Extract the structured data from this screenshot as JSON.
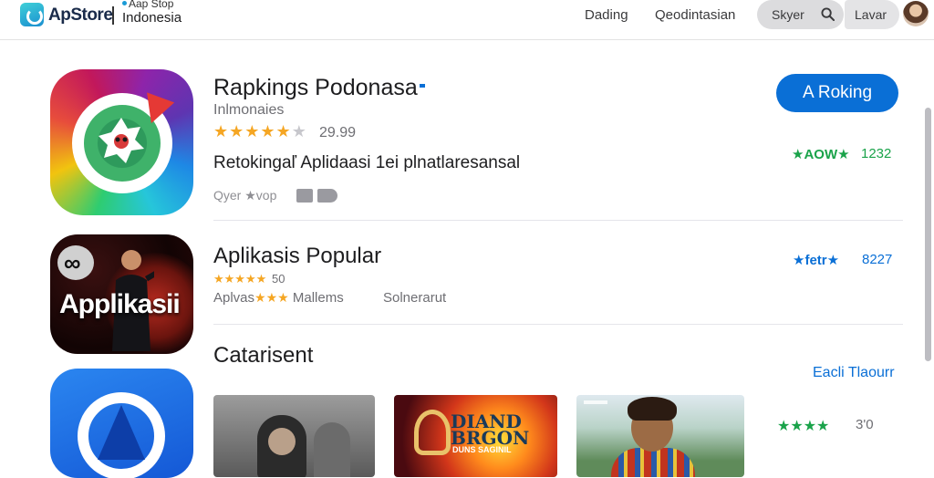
{
  "header": {
    "logo_text": "ApStore",
    "logo_sub_top": "Aap Stop",
    "logo_sub_bottom": "Indonesia",
    "nav": [
      "Dading",
      "Qeodintasian"
    ],
    "search_label": "Skyer",
    "language_label": "Lavar"
  },
  "featured": {
    "title": "Rapkings Podonasa",
    "subtitle": "Inlmonaies",
    "stars": "★★★★★",
    "stars_dim": "★",
    "rating_count": "29.99",
    "description": "Retokingaľ Aplidaasi 1ei plnatlaresansal",
    "meta": "Qyer ★vop",
    "get_button": "A Roking",
    "score_label": "★AOW★",
    "score_value": "1232"
  },
  "popular": {
    "title": "Aplikasis Popular",
    "icon_text": "Applikasii",
    "stars": "★★★★★",
    "rating": "50",
    "category_prefix": "Aplvas",
    "category_stars": "★★★",
    "category_suffix": "Mallems",
    "seller": "Solnerarut",
    "score_label": "★fetr★",
    "score_value": "8227"
  },
  "section": {
    "title": "Catarisent",
    "see_all": "Eacli Tlaourr",
    "score_label": "★★★★",
    "score_value": "3'0"
  },
  "thumbnails": [
    {
      "caption": ""
    },
    {
      "art_title": "DIAND BRGON",
      "art_sub": "DUNS SAGINIL"
    },
    {
      "caption": ""
    }
  ],
  "colors": {
    "accent_blue": "#0a6fd6",
    "star_orange": "#f5a623",
    "score_green": "#1aa34a"
  }
}
